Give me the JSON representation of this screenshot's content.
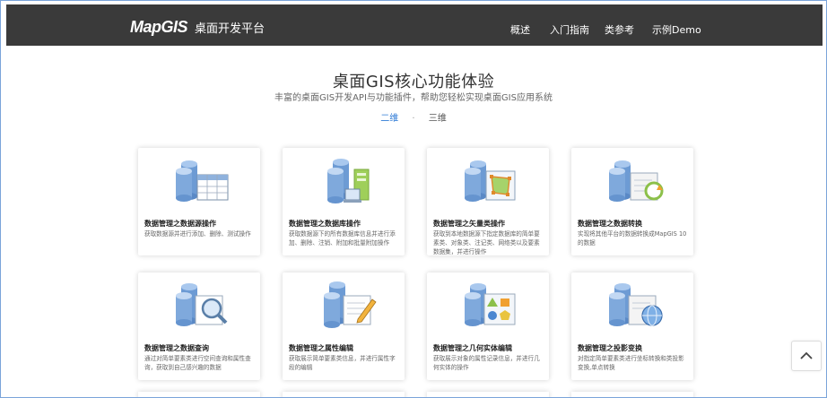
{
  "header": {
    "logo_brand": "MapGIS",
    "logo_sub": "桌面开发平台",
    "nav": [
      "概述",
      "入门指南",
      "类参考",
      "示例Demo"
    ]
  },
  "hero": {
    "title": "桌面GIS核心功能体验",
    "subtitle": "丰富的桌面GIS开发API与功能插件，帮助您轻松实现桌面GIS应用系统"
  },
  "tabs": [
    "二维",
    "三维"
  ],
  "tab_separator": "·",
  "cards": [
    {
      "title": "数据管理之数据源操作",
      "desc": "获取数据源并进行添加、删除、测试操作",
      "icon": "database-table-icon"
    },
    {
      "title": "数据管理之数据库操作",
      "desc": "获取数据源下的所有数据库信息并进行添加、删除、注销、附加和批量附加操作",
      "icon": "database-server-icon"
    },
    {
      "title": "数据管理之矢量类操作",
      "desc": "获取到本地数据源下指定数据库的简单要素类、对象类、注记类、网络类以及要素数据集，并进行操作",
      "icon": "database-vector-icon"
    },
    {
      "title": "数据管理之数据转换",
      "desc": "实现将其他平台的数据转换成MapGIS 10的数据",
      "icon": "database-convert-icon"
    },
    {
      "title": "数据管理之数据查询",
      "desc": "通过对简单要素类进行空间查询和属性查询，获取到自己感兴趣的数据",
      "icon": "database-search-icon"
    },
    {
      "title": "数据管理之属性编辑",
      "desc": "获取展示简单要素类信息，并进行属性字段的编辑",
      "icon": "database-edit-icon"
    },
    {
      "title": "数据管理之几何实体编辑",
      "desc": "获取展示对象的属性记录信息，并进行几何实体的操作",
      "icon": "database-geometry-icon"
    },
    {
      "title": "数据管理之投影变换",
      "desc": "对指定简单要素类进行坐标转换和类投影变换,单点转换",
      "icon": "database-projection-icon"
    }
  ],
  "back_to_top_icon": "chevron-up-icon",
  "colors": {
    "header_bg": "#3a3a3a",
    "accent": "#2f7bd6",
    "frame_border": "#7aa4da"
  }
}
